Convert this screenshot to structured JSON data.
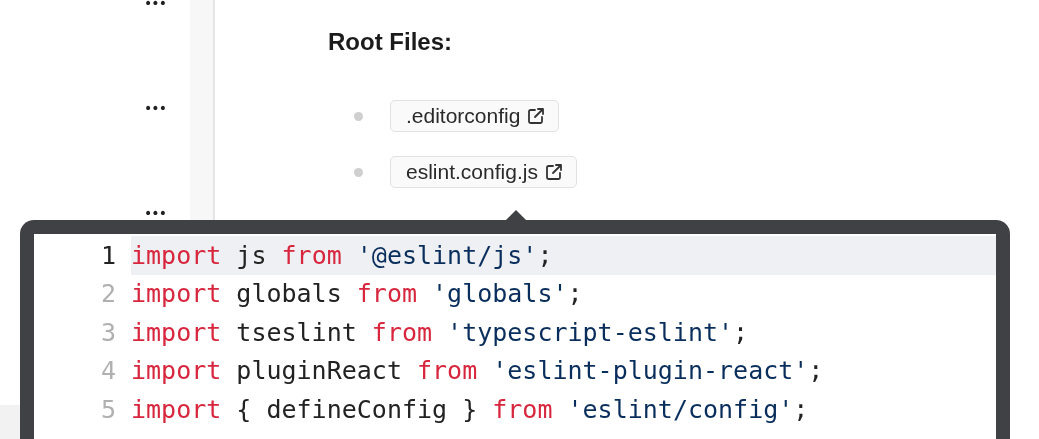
{
  "sidebar": {
    "items": [
      "•••",
      "•••",
      "•••"
    ]
  },
  "section": {
    "title": "Root Files:",
    "files": [
      {
        "name": ".editorconfig"
      },
      {
        "name": "eslint.config.js"
      }
    ]
  },
  "code_popup": {
    "lines": [
      {
        "number": "1",
        "current": true,
        "tokens": [
          {
            "kind": "keyword",
            "text": "import"
          },
          {
            "kind": "plain",
            "text": " js "
          },
          {
            "kind": "keyword",
            "text": "from"
          },
          {
            "kind": "string",
            "text": " '@eslint/js'"
          },
          {
            "kind": "plain",
            "text": ";"
          }
        ]
      },
      {
        "number": "2",
        "current": false,
        "tokens": [
          {
            "kind": "keyword",
            "text": "import"
          },
          {
            "kind": "plain",
            "text": " globals "
          },
          {
            "kind": "keyword",
            "text": "from"
          },
          {
            "kind": "string",
            "text": " 'globals'"
          },
          {
            "kind": "plain",
            "text": ";"
          }
        ]
      },
      {
        "number": "3",
        "current": false,
        "tokens": [
          {
            "kind": "keyword",
            "text": "import"
          },
          {
            "kind": "plain",
            "text": " tseslint "
          },
          {
            "kind": "keyword",
            "text": "from"
          },
          {
            "kind": "string",
            "text": " 'typescript-eslint'"
          },
          {
            "kind": "plain",
            "text": ";"
          }
        ]
      },
      {
        "number": "4",
        "current": false,
        "tokens": [
          {
            "kind": "keyword",
            "text": "import"
          },
          {
            "kind": "plain",
            "text": " pluginReact "
          },
          {
            "kind": "keyword",
            "text": "from"
          },
          {
            "kind": "string",
            "text": " 'eslint-plugin-react'"
          },
          {
            "kind": "plain",
            "text": ";"
          }
        ]
      },
      {
        "number": "5",
        "current": false,
        "tokens": [
          {
            "kind": "keyword",
            "text": "import"
          },
          {
            "kind": "plain",
            "text": " { defineConfig } "
          },
          {
            "kind": "keyword",
            "text": "from"
          },
          {
            "kind": "string",
            "text": " 'eslint/config'"
          },
          {
            "kind": "plain",
            "text": ";"
          }
        ]
      }
    ]
  }
}
